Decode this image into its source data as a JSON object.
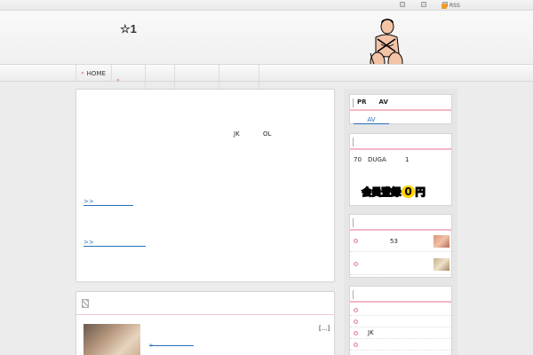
{
  "header": {
    "site_title": "☆1",
    "top_links": [
      "",
      "",
      ""
    ],
    "rss_label": "RSS"
  },
  "nav": {
    "items": [
      {
        "label": "HOME"
      },
      {
        "label": ""
      },
      {
        "label": ""
      },
      {
        "label": ""
      },
      {
        "label": ""
      }
    ]
  },
  "post1": {
    "text_jk": "JK",
    "text_ol": "OL",
    "more_link_1": ">>",
    "more_link_2": ">>"
  },
  "post2": {
    "ellipsis": "[...]",
    "link_arrow": "»"
  },
  "sidebar": {
    "widget1": {
      "title_a": "PR",
      "title_b": "AV",
      "link": "AV"
    },
    "widget2": {
      "t70": "70",
      "duga": "DUGA",
      "t1": "1",
      "banner_text_a": "会員登録",
      "banner_zero": "0",
      "banner_text_b": "円"
    },
    "widget3": {
      "rows": [
        {
          "num": "53"
        },
        {
          "num": ""
        }
      ]
    },
    "widget4": {
      "rows": [
        {
          "label": ""
        },
        {
          "label": ""
        },
        {
          "label": "JK"
        },
        {
          "label": ""
        }
      ]
    }
  },
  "colors": {
    "accent_pink": "#f2b8c6",
    "link_blue": "#2a6fb8",
    "rss_orange": "#f29a2e",
    "banner_yellow": "#ffd400"
  }
}
